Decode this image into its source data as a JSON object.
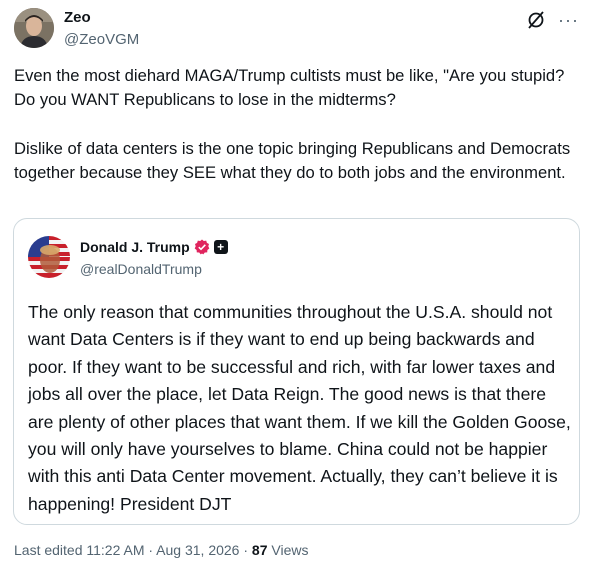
{
  "author": {
    "name": "Zeo",
    "handle": "@ZeoVGM"
  },
  "icons": {
    "grok": "grok-icon",
    "more": "more-icon",
    "verified": "verified-badge-icon",
    "affiliate": "plus-icon"
  },
  "tweet": {
    "paragraph1": "Even the most diehard MAGA/Trump cultists must be like, \"Are you stupid? Do you WANT Republicans to lose in the midterms?",
    "paragraph2": "Dislike of data centers is the one topic bringing Republicans and Democrats together because they SEE what they do to both jobs and the environment."
  },
  "quote": {
    "name": "Donald J. Trump",
    "handle": "@realDonaldTrump",
    "text": "The only reason that communities throughout the U.S.A. should not want Data Centers is if they want to end up being backwards and poor. If they want to be successful and rich, with far lower taxes and jobs all over the place, let Data Reign. The good news is that there are plenty of other places that want them. If we kill the Golden Goose, you will only have yourselves to blame. China could not be happier with this anti Data Center movement. Actually, they can’t believe it is happening! President DJT"
  },
  "meta": {
    "edited": "Last edited 11:22 AM · Aug 31, 2026 · ",
    "views_count": "87",
    "views_label": " Views"
  },
  "colors": {
    "text": "#0f1419",
    "secondary": "#536471",
    "border": "#cfd9de",
    "verified": "#e0245e"
  }
}
